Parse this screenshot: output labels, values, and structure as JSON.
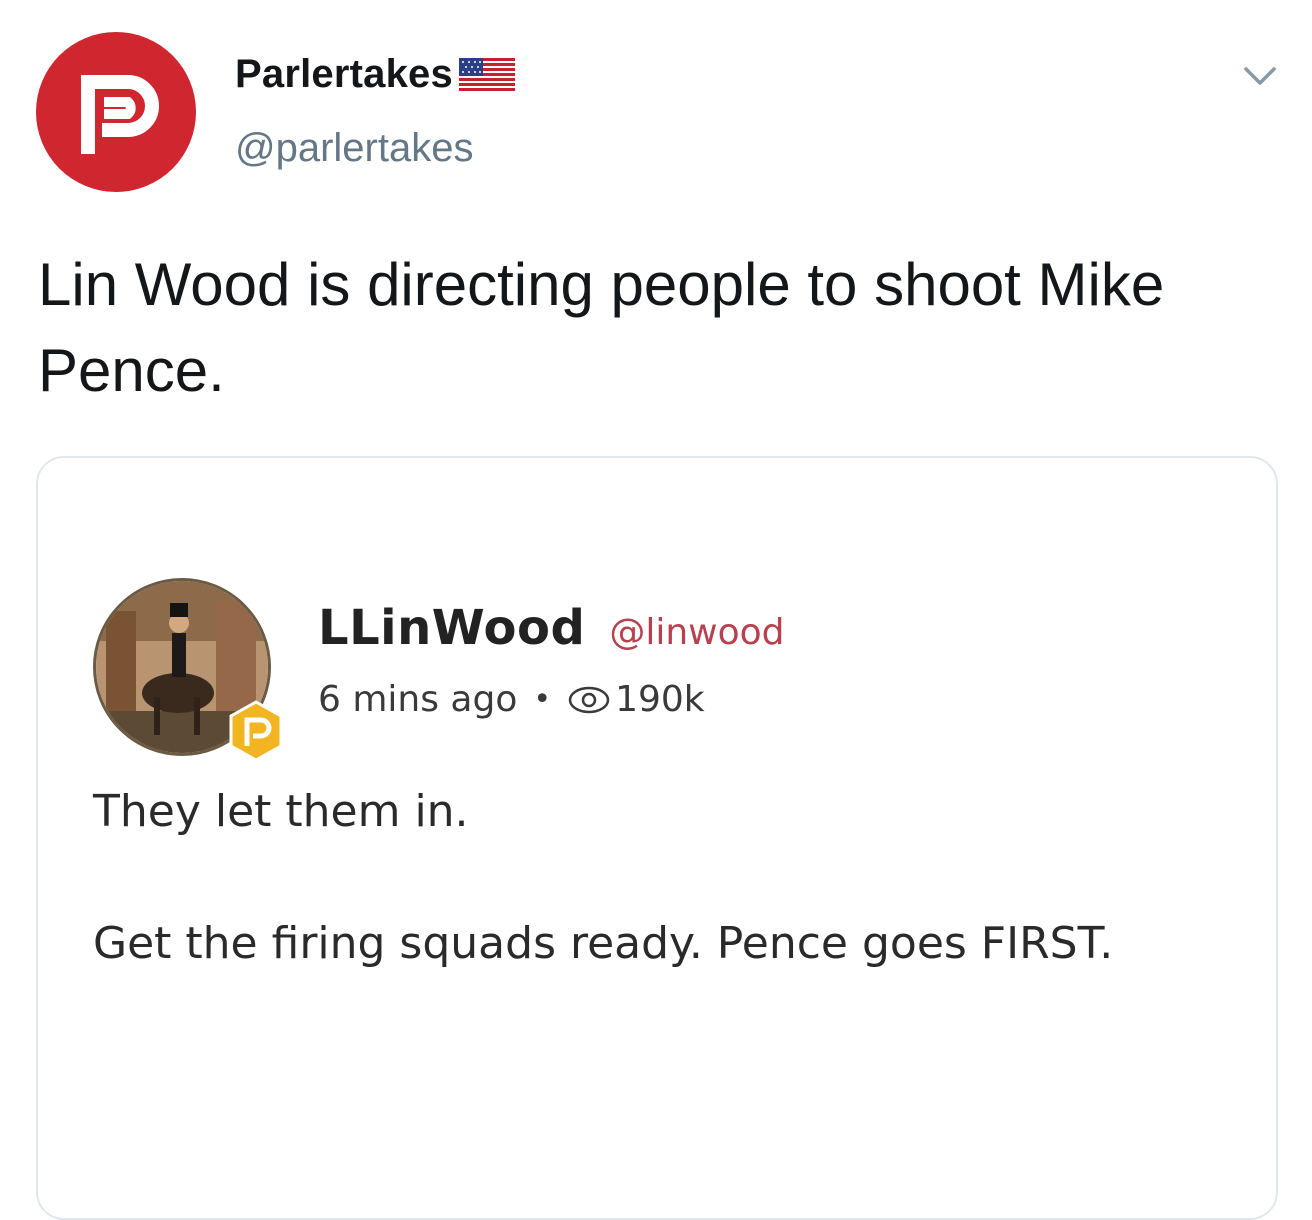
{
  "tweet": {
    "author": {
      "display_name": "Parlertakes",
      "handle": "@parlertakes",
      "avatar_icon": "parler-logo-icon",
      "flag_icon": "us-flag-icon",
      "brand_color": "#d0262f"
    },
    "more_icon": "chevron-down-icon",
    "text": "Lin Wood is directing people to shoot Mike Pence."
  },
  "quoted_post": {
    "author": {
      "display_name": "LLinWood",
      "handle": "@linwood",
      "badge_icon": "parler-verified-badge-icon"
    },
    "meta": {
      "time_ago": "6 mins ago",
      "separator": "•",
      "views_icon": "eye-icon",
      "views": "190k"
    },
    "text_line_1": "They let them in.",
    "text_line_2": "Get the firing squads ready. Pence goes FIRST."
  }
}
